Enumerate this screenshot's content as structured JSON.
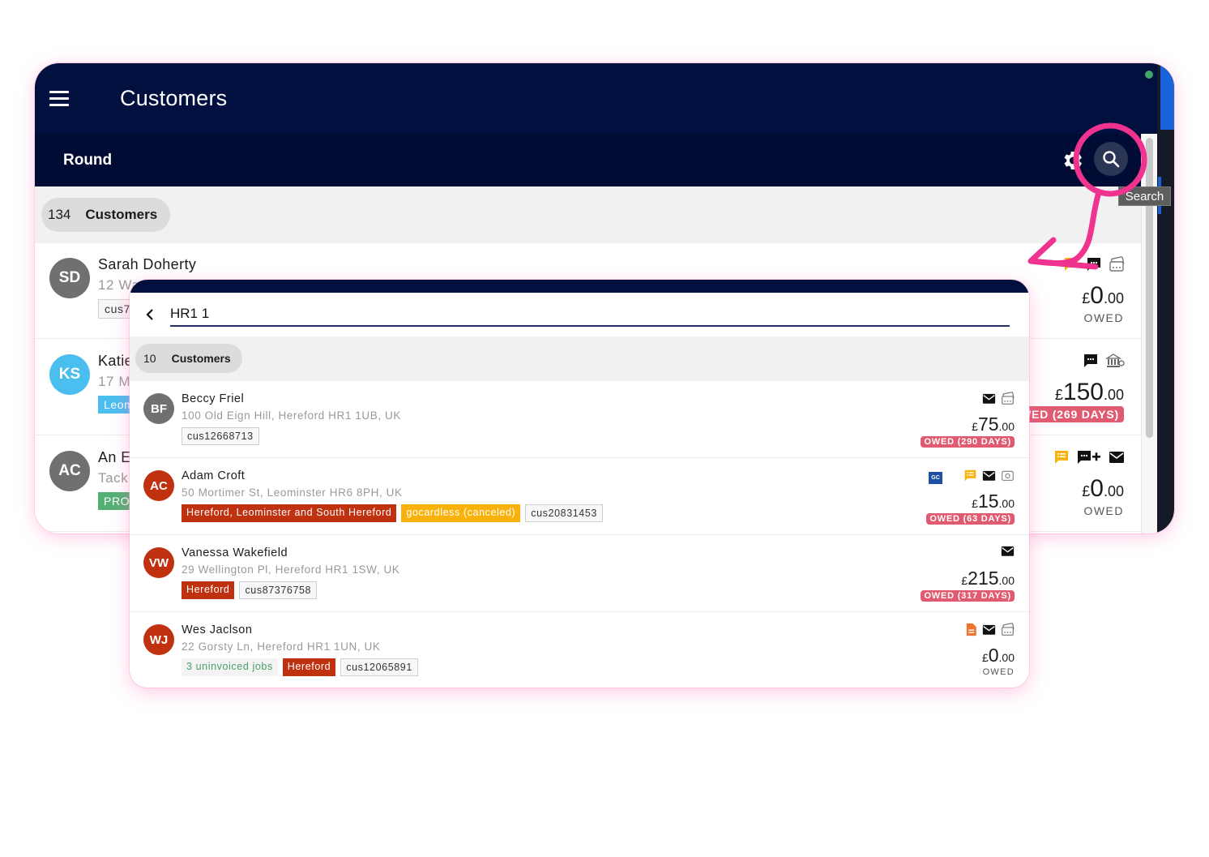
{
  "app": {
    "title": "Customers",
    "subtitle": "Round",
    "customer_count": "134",
    "customer_count_label": "Customers",
    "tooltip": "Search",
    "colors": {
      "appbar": "#02103f",
      "subbar": "#000c33",
      "accent_pink": "#f0338f",
      "owed_badge": "#e05b70",
      "tag_red": "#c0310f"
    }
  },
  "background_list": [
    {
      "initials": "SD",
      "avatar_color": "#707070",
      "name": "Sarah Doherty",
      "address": "12 Wa",
      "tags": [
        {
          "text": "cus7",
          "style": "id"
        }
      ],
      "icons": [
        "notes-icon",
        "chat-icon",
        "card-icon"
      ],
      "amount_whole": "0",
      "amount_cents": ".00",
      "currency": "£",
      "status": "OWED",
      "overdue": false
    },
    {
      "initials": "KS",
      "avatar_color": "#4bbef0",
      "name": "Katie",
      "address": "17 M",
      "tags": [
        {
          "text": "Leom",
          "style": "blue"
        }
      ],
      "icons": [
        "chat-icon",
        "bank-icon"
      ],
      "amount_whole": "150",
      "amount_cents": ".00",
      "currency": "£",
      "status": "WED (269 DAYS)",
      "overdue": true
    },
    {
      "initials": "AC",
      "avatar_color": "#707070",
      "name": "An E",
      "address": "Tack",
      "tags": [
        {
          "text": "PROS",
          "style": "green"
        }
      ],
      "icons": [
        "notes-icon",
        "add-comment-icon",
        "mail-icon"
      ],
      "amount_whole": "0",
      "amount_cents": ".00",
      "currency": "£",
      "status": "OWED",
      "overdue": false
    }
  ],
  "search": {
    "query": "HR1 1",
    "result_count": "10",
    "result_count_label": "Customers",
    "results": [
      {
        "initials": "BF",
        "avatar_color": "#707070",
        "name": "Beccy Friel",
        "address": "100 Old Eign Hill, Hereford HR1 1UB, UK",
        "tags": [
          {
            "text": "cus12668713",
            "style": "id"
          }
        ],
        "icons": [
          "mail-icon",
          "card-icon"
        ],
        "currency": "£",
        "amount_whole": "75",
        "amount_cents": ".00",
        "status": "OWED (290 DAYS)",
        "overdue": true
      },
      {
        "initials": "AC",
        "avatar_color": "#c0310f",
        "name": "Adam Croft",
        "address": "50 Mortimer St, Leominster HR6 8PH, UK",
        "tags": [
          {
            "text": "Hereford, Leominster and South Hereford",
            "style": "red"
          },
          {
            "text": "gocardless (canceled)",
            "style": "yellow"
          },
          {
            "text": "cus20831453",
            "style": "id"
          }
        ],
        "icons": [
          "gocardless-icon",
          "notes-icon",
          "mail-icon",
          "cash-icon"
        ],
        "currency": "£",
        "amount_whole": "15",
        "amount_cents": ".00",
        "status": "OWED (63 DAYS)",
        "overdue": true
      },
      {
        "initials": "VW",
        "avatar_color": "#c0310f",
        "name": "Vanessa Wakefield",
        "address": "29 Wellington Pl, Hereford HR1 1SW, UK",
        "tags": [
          {
            "text": "Hereford",
            "style": "red"
          },
          {
            "text": "cus87376758",
            "style": "id"
          }
        ],
        "icons": [
          "mail-icon"
        ],
        "currency": "£",
        "amount_whole": "215",
        "amount_cents": ".00",
        "status": "OWED (317 DAYS)",
        "overdue": true
      },
      {
        "initials": "WJ",
        "avatar_color": "#c0310f",
        "name": "Wes Jaclson",
        "address": "22 Gorsty Ln, Hereford HR1 1UN, UK",
        "tags": [
          {
            "text": "3 uninvoiced jobs",
            "style": "green-text"
          },
          {
            "text": "Hereford",
            "style": "red"
          },
          {
            "text": "cus12065891",
            "style": "id"
          }
        ],
        "icons": [
          "document-icon",
          "mail-icon",
          "card-icon"
        ],
        "currency": "£",
        "amount_whole": "0",
        "amount_cents": ".00",
        "status": "OWED",
        "overdue": false
      }
    ]
  }
}
